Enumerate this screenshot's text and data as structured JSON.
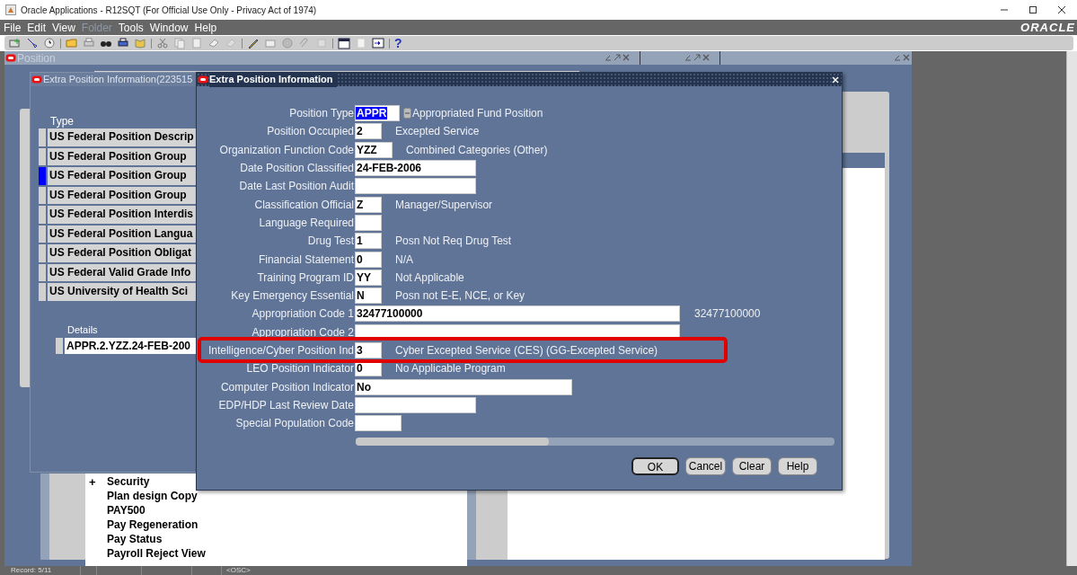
{
  "window": {
    "title": "Oracle Applications - R12SQT (For Official Use Only - Privacy Act of 1974)"
  },
  "menu": [
    {
      "label": "File",
      "disabled": false
    },
    {
      "label": "Edit",
      "disabled": false
    },
    {
      "label": "View",
      "disabled": false
    },
    {
      "label": "Folder",
      "disabled": true
    },
    {
      "label": "Tools",
      "disabled": false
    },
    {
      "label": "Window",
      "disabled": false
    },
    {
      "label": "Help",
      "disabled": false
    }
  ],
  "brand": "ORACLE",
  "toolbar": {
    "help": "?"
  },
  "position_window": {
    "title": "Position",
    "tree_items": [
      {
        "label": "Security",
        "expander": "+"
      },
      {
        "label": "Plan design Copy"
      },
      {
        "label": "PAY500"
      },
      {
        "label": "Pay Regeneration"
      },
      {
        "label": "Pay Status"
      },
      {
        "label": "Payroll Reject View"
      }
    ]
  },
  "eit_window": {
    "title": "Extra Position Information(223515",
    "type_header": "Type",
    "rows": [
      {
        "label": "US Federal Position Descrip",
        "selected": false
      },
      {
        "label": "US Federal Position Group",
        "selected": false
      },
      {
        "label": "US Federal Position Group",
        "selected": true
      },
      {
        "label": "US Federal Position Group",
        "selected": false
      },
      {
        "label": "US Federal Position Interdis",
        "selected": false
      },
      {
        "label": "US Federal Position Langua",
        "selected": false
      },
      {
        "label": "US Federal Position Obligat",
        "selected": false
      },
      {
        "label": "US Federal Valid Grade Info",
        "selected": false
      },
      {
        "label": "US University of Health Sci",
        "selected": false
      }
    ],
    "details_label": "Details",
    "details_value": "APPR.2.YZZ.24-FEB-200"
  },
  "dialog": {
    "title": "Extra Position Information",
    "fields": [
      {
        "label": "Position Type",
        "kind": "lov",
        "value": "APPR",
        "description": "Appropriated Fund Position",
        "focused": true,
        "annotated": false
      },
      {
        "label": "Position Occupied",
        "kind": "code",
        "value": "2",
        "description": "Excepted Service",
        "focused": false,
        "annotated": false
      },
      {
        "label": "Organization Function Code",
        "kind": "code3",
        "value": "YZZ",
        "description": "Combined Categories (Other)",
        "focused": false,
        "annotated": false
      },
      {
        "label": "Date Position Classified",
        "kind": "date",
        "value": "24-FEB-2006",
        "focused": false,
        "annotated": false
      },
      {
        "label": "Date Last Position Audit",
        "kind": "date",
        "focused": false,
        "annotated": false
      },
      {
        "label": "Classification Official",
        "kind": "code",
        "value": "Z",
        "description": "Manager/Supervisor",
        "focused": false,
        "annotated": false
      },
      {
        "label": "Language Required",
        "kind": "code",
        "focused": false,
        "annotated": false
      },
      {
        "label": "Drug Test",
        "kind": "code",
        "value": "1",
        "description": "Posn Not Req Drug Test",
        "focused": false,
        "annotated": false
      },
      {
        "label": "Financial Statement",
        "kind": "code",
        "value": "0",
        "description": "N/A",
        "focused": false,
        "annotated": false
      },
      {
        "label": "Training Program ID",
        "kind": "code",
        "value": "YY",
        "description": "Not Applicable",
        "focused": false,
        "annotated": false
      },
      {
        "label": "Key Emergency Essential",
        "kind": "code",
        "value": "N",
        "description": "Posn not E-E, NCE, or Key",
        "focused": false,
        "annotated": false
      },
      {
        "label": "Appropriation Code 1",
        "kind": "wide",
        "value": "32477100000",
        "description": "32477100000",
        "focused": false,
        "annotated": false
      },
      {
        "label": "Appropriation Code 2",
        "kind": "wide",
        "focused": false,
        "annotated": false
      },
      {
        "label": "Intelligence/Cyber Position Ind",
        "kind": "code",
        "value": "3",
        "description": "Cyber Excepted Service (CES) (GG-Excepted Service)",
        "focused": false,
        "annotated": true
      },
      {
        "label": "LEO Position Indicator",
        "kind": "code",
        "value": "0",
        "description": "No Applicable Program",
        "focused": false,
        "annotated": false
      },
      {
        "label": "Computer Position Indicator",
        "kind": "medium",
        "value": "No",
        "focused": false,
        "annotated": false
      },
      {
        "label": "EDP/HDP Last Review Date",
        "kind": "date",
        "focused": false,
        "annotated": false
      },
      {
        "label": "Special Population Code",
        "kind": "short",
        "focused": false,
        "annotated": false
      }
    ],
    "buttons": [
      "OK",
      "Cancel",
      "Clear",
      "Help"
    ]
  },
  "status_bar": {
    "record": "Record: 5/11",
    "mode": "<OSC>"
  }
}
